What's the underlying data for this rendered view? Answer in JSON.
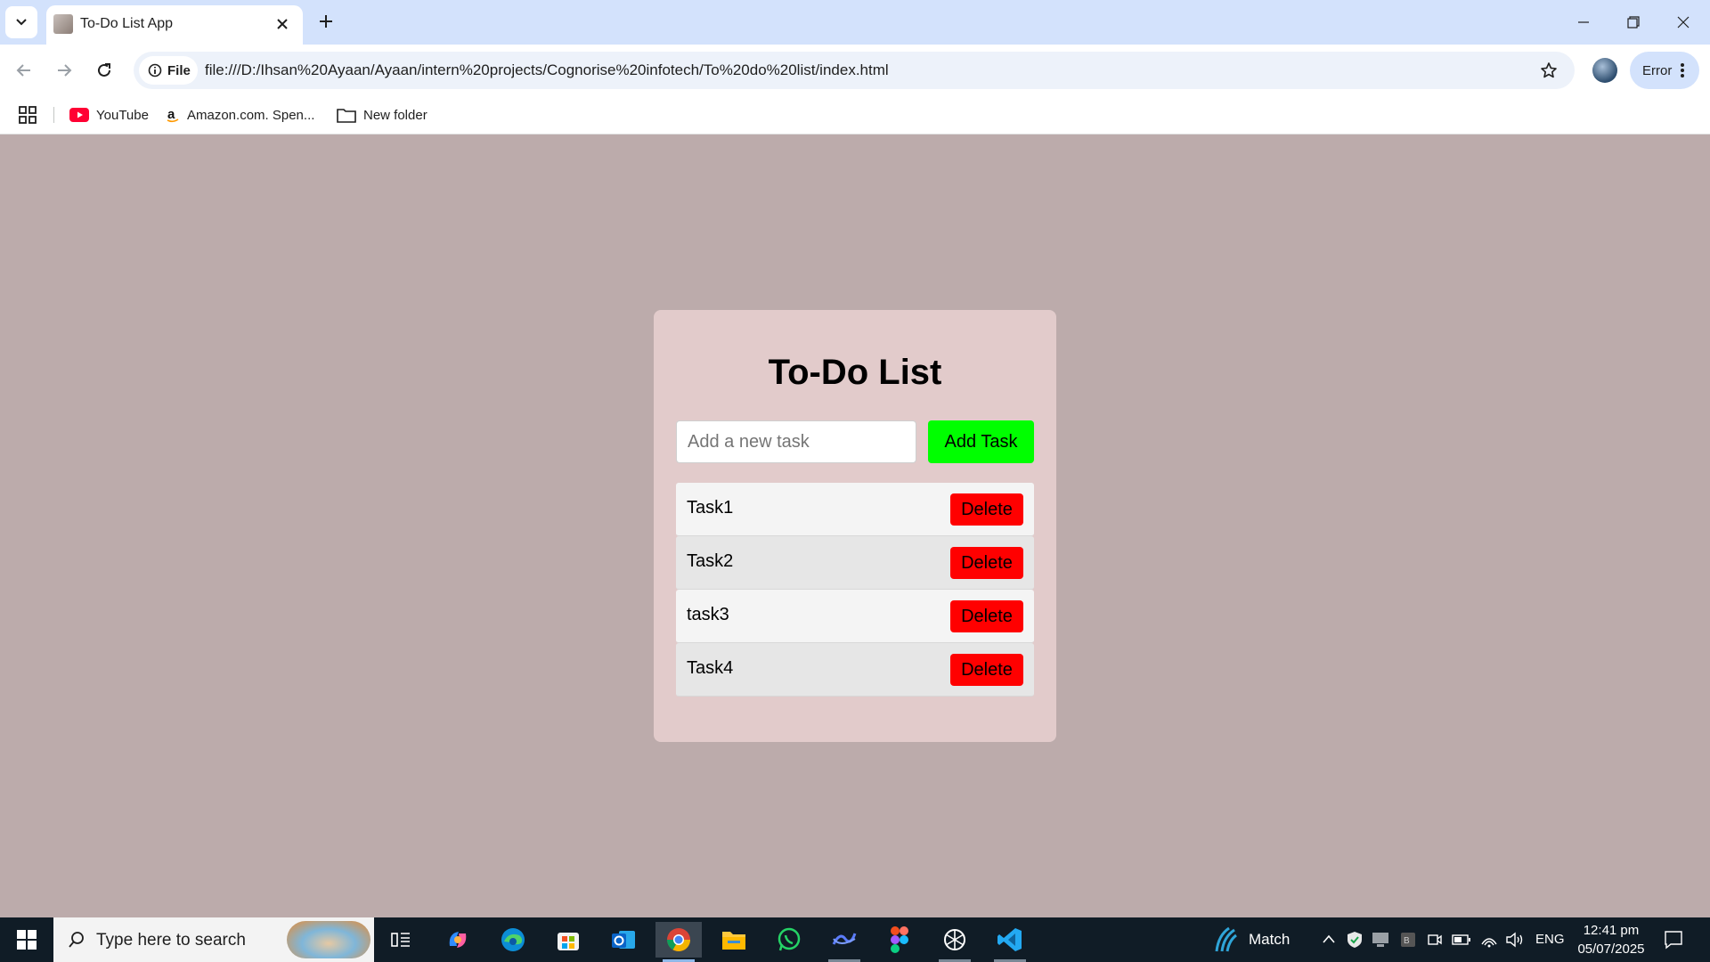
{
  "browser": {
    "tab": {
      "title": "To-Do List App"
    },
    "address": {
      "scheme_chip": "File",
      "url": "file:///D:/Ihsan%20Ayaan/Ayaan/intern%20projects/Cognorise%20infotech/To%20do%20list/index.html"
    },
    "profile_chip": "Error",
    "bookmarks": [
      {
        "label": "YouTube",
        "icon": "youtube-icon"
      },
      {
        "label": "Amazon.com. Spen...",
        "icon": "amazon-icon"
      },
      {
        "label": "New folder",
        "icon": "folder-icon"
      }
    ]
  },
  "app": {
    "title": "To-Do List",
    "input": {
      "placeholder": "Add a new task",
      "value": ""
    },
    "add_button": "Add Task",
    "tasks": [
      {
        "label": "Task1",
        "delete": "Delete"
      },
      {
        "label": "Task2",
        "delete": "Delete"
      },
      {
        "label": "task3",
        "delete": "Delete"
      },
      {
        "label": "Task4",
        "delete": "Delete"
      }
    ],
    "colors": {
      "add": "#00ff00",
      "delete": "#ff0000",
      "card": "#e2cbcb",
      "background": "#bcabab"
    }
  },
  "taskbar": {
    "search_placeholder": "Type here to search",
    "weather_label": "Match",
    "language": "ENG",
    "time": "12:41 pm",
    "date": "05/07/2025"
  }
}
